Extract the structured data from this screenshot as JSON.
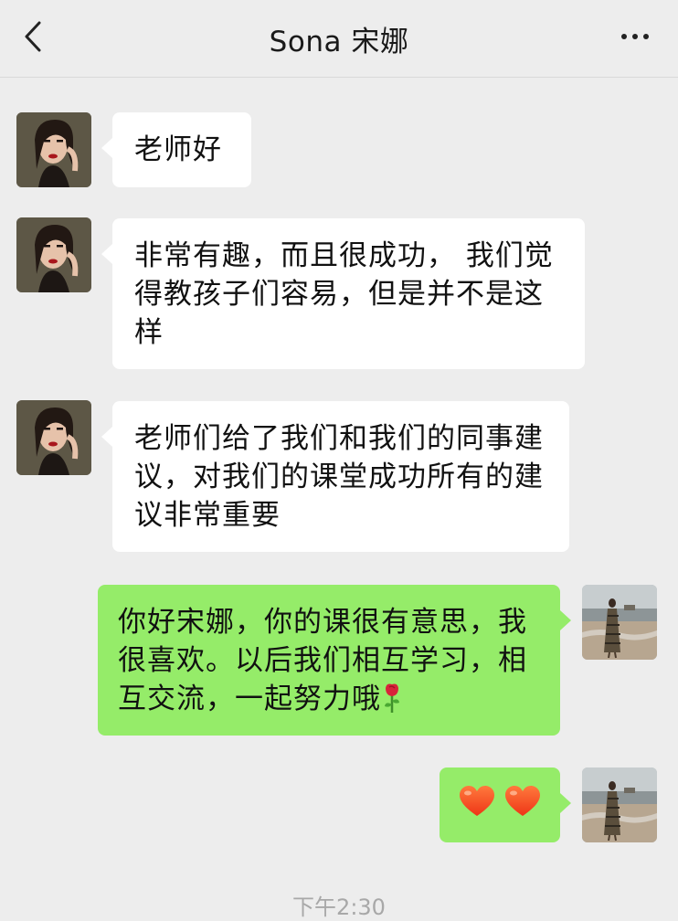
{
  "header": {
    "title": "Sona 宋娜"
  },
  "messages": [
    {
      "direction": "incoming",
      "text": "老师好"
    },
    {
      "direction": "incoming",
      "text": "非常有趣，而且很成功， 我们觉得教孩子们容易，但是并不是这样"
    },
    {
      "direction": "incoming",
      "text": "老师们给了我们和我们的同事建议，对我们的课堂成功所有的建议非常重要"
    },
    {
      "direction": "outgoing",
      "text": "你好宋娜，你的课很有意思，我很喜欢。以后我们相互学习，相互交流，一起努力哦",
      "emoji": "rose"
    },
    {
      "direction": "outgoing",
      "text": "❤️❤️"
    }
  ],
  "timestamp": "下午2:30",
  "colors": {
    "outgoing_bubble": "#95ec69",
    "incoming_bubble": "#ffffff",
    "background": "#ededed"
  }
}
